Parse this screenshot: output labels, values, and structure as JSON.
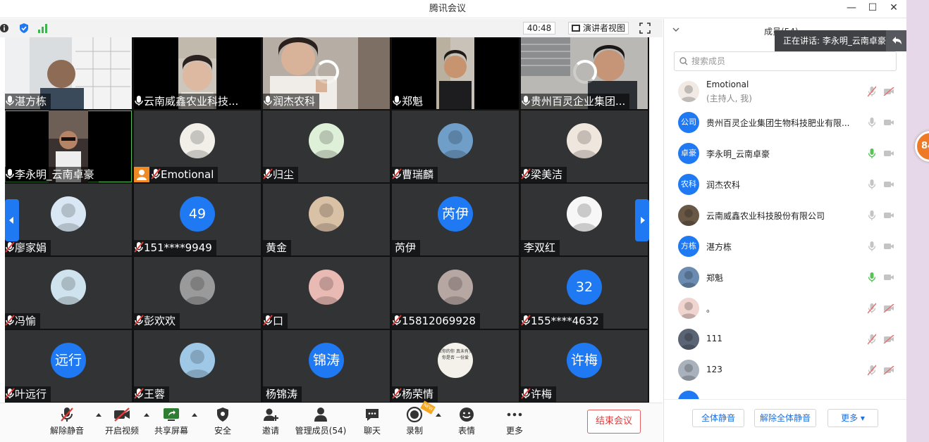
{
  "window": {
    "title": "腾讯会议"
  },
  "infobar": {
    "timer": "40:48",
    "speaker_view_label": "演讲者视图"
  },
  "tiles": [
    {
      "name": "湛方栋",
      "kind": "video",
      "scene": "office",
      "mic": "on"
    },
    {
      "name": "云南威鑫农业科技...",
      "kind": "video",
      "scene": "girl",
      "mic": "on"
    },
    {
      "name": "润杰农科",
      "kind": "video",
      "scene": "girl2",
      "mic": "on",
      "loading": true
    },
    {
      "name": "郑魁",
      "kind": "video",
      "scene": "man",
      "mic": "on"
    },
    {
      "name": "贵州百灵企业集团...",
      "kind": "video",
      "scene": "man2",
      "mic": "on",
      "loading": true
    },
    {
      "name": "李永明_云南卓豪",
      "kind": "video",
      "scene": "car",
      "mic": "on",
      "active": true
    },
    {
      "name": "Emotional",
      "kind": "avatar",
      "color": "#f2efe9",
      "mic": "muted",
      "host": true
    },
    {
      "name": "归尘",
      "kind": "avatar",
      "color": "#dff0d8",
      "mic": "muted"
    },
    {
      "name": "曹瑞麟",
      "kind": "avatar",
      "color": "#6f9fc9",
      "mic": "muted"
    },
    {
      "name": "梁美洁",
      "kind": "avatar",
      "color": "#efe6dd",
      "mic": "muted"
    },
    {
      "name": "廖家娟",
      "kind": "avatar",
      "color": "#d8e7f3",
      "mic": "muted"
    },
    {
      "name": "151****9949",
      "kind": "text",
      "avatar_text": "49",
      "mic": "muted"
    },
    {
      "name": "黄金",
      "kind": "avatar",
      "color": "#d9c1a6",
      "mic": "none"
    },
    {
      "name": "芮伊",
      "kind": "text",
      "avatar_text": "芮伊",
      "mic": "none"
    },
    {
      "name": "李双红",
      "kind": "avatar",
      "color": "#f7f7f7",
      "mic": "none"
    },
    {
      "name": "冯愉",
      "kind": "avatar",
      "color": "#cfe3ee",
      "mic": "muted"
    },
    {
      "name": "彭欢欢",
      "kind": "avatar",
      "color": "#9a9a9a",
      "mic": "muted"
    },
    {
      "name": "口",
      "kind": "avatar",
      "color": "#e9b9b4",
      "mic": "muted"
    },
    {
      "name": "15812069928",
      "kind": "avatar",
      "color": "#b7a7a3",
      "mic": "muted"
    },
    {
      "name": "155****4632",
      "kind": "text",
      "avatar_text": "32",
      "mic": "muted"
    },
    {
      "name": "叶远行",
      "kind": "text",
      "avatar_text": "远行",
      "mic": "muted"
    },
    {
      "name": "王蓉",
      "kind": "avatar",
      "color": "#9fc8e6",
      "mic": "muted"
    },
    {
      "name": "杨锦涛",
      "kind": "text",
      "avatar_text": "锦涛",
      "mic": "none"
    },
    {
      "name": "杨荣情",
      "kind": "avatar",
      "color": "#f4f1ea",
      "mic": "muted",
      "avatar_text": "若你的你 真未有见 你是否 一份爱"
    },
    {
      "name": "许梅",
      "kind": "text",
      "avatar_text": "许梅",
      "mic": "muted"
    }
  ],
  "toolbar": {
    "unmute": "解除静音",
    "video": "开启视频",
    "share": "共享屏幕",
    "security": "安全",
    "invite": "邀请",
    "manage": "管理成员(54)",
    "chat": "聊天",
    "record": "录制",
    "record_badge": "NEW",
    "emoji": "表情",
    "more": "更多",
    "end": "结束会议"
  },
  "panel": {
    "title": "成员(54)",
    "speaking_tip": "正在讲话: 李永明_云南卓豪;",
    "search_placeholder": "搜索成员",
    "members": [
      {
        "name": "Emotional",
        "role": "(主持人, 我)",
        "avatar": "img",
        "color": "#f1e9e4",
        "mic": "off",
        "cam": "off"
      },
      {
        "name": "贵州百灵企业集团生物科技肥业有限...",
        "avatar_text": "公司",
        "mic": "gray",
        "cam": "gray"
      },
      {
        "name": "李永明_云南卓豪",
        "avatar_text": "卓豪",
        "mic": "green",
        "cam": "gray"
      },
      {
        "name": "润杰农科",
        "avatar_text": "农科",
        "mic": "gray",
        "cam": "gray"
      },
      {
        "name": "云南威鑫农业科技股份有限公司",
        "avatar": "img",
        "color": "#6a5846",
        "mic": "gray",
        "cam": "gray"
      },
      {
        "name": "湛方栋",
        "avatar_text": "方栋",
        "mic": "gray",
        "cam": "gray"
      },
      {
        "name": "郑魁",
        "avatar": "img",
        "color": "#6b8cb0",
        "mic": "green",
        "cam": "gray"
      },
      {
        "name": "。",
        "avatar": "img",
        "color": "#f0d4cf",
        "mic": "off",
        "cam": "off"
      },
      {
        "name": "111",
        "avatar": "img",
        "color": "#5a6475",
        "mic": "off",
        "cam": "off"
      },
      {
        "name": "123",
        "avatar": "img",
        "color": "#a9b2bc",
        "mic": "off",
        "cam": "off"
      }
    ],
    "mute_all": "全体静音",
    "unmute_all": "解除全体静音",
    "more": "更多"
  },
  "floating_badge": "84"
}
